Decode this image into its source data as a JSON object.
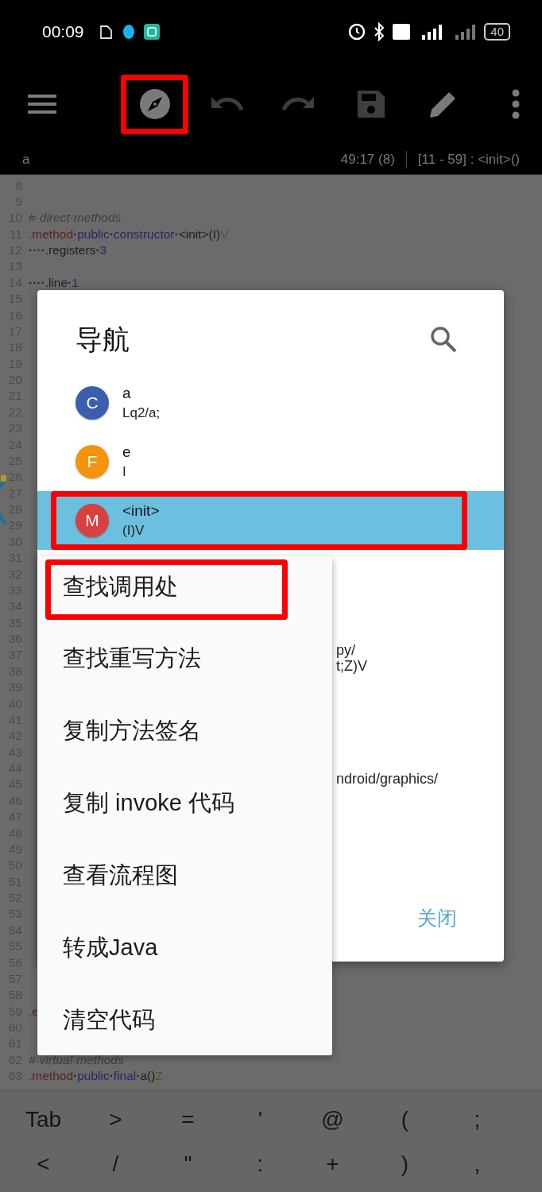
{
  "status_bar": {
    "time": "00:09",
    "battery": "40"
  },
  "toolbar": {
    "buttons": [
      {
        "disabled": false,
        "highlighted": false
      },
      {
        "disabled": false,
        "highlighted": true
      },
      {
        "disabled": true,
        "highlighted": false
      },
      {
        "disabled": true,
        "highlighted": false
      },
      {
        "disabled": true,
        "highlighted": false
      },
      {
        "disabled": false,
        "highlighted": false
      },
      {
        "disabled": false,
        "highlighted": false
      }
    ]
  },
  "info_bar": {
    "file": "a",
    "position": "49:17 (8)",
    "range": "[11 - 59] : <init>()"
  },
  "editor": {
    "lines": [
      {
        "number": "8"
      },
      {
        "number": "9"
      },
      {
        "number": "10",
        "tokens": [
          {
            "kind": "comment",
            "text": "#·direct·methods"
          }
        ]
      },
      {
        "number": "11",
        "tokens": [
          {
            "kind": "directive",
            "text": ".method"
          },
          {
            "kind": "space",
            "text": "·"
          },
          {
            "kind": "keyword",
            "text": "public"
          },
          {
            "kind": "space",
            "text": "·"
          },
          {
            "kind": "keyword",
            "text": "constructor"
          },
          {
            "kind": "space",
            "text": "·"
          },
          {
            "kind": "plain",
            "text": "<init>(I)"
          },
          {
            "kind": "type",
            "text": "V"
          }
        ]
      },
      {
        "number": "12",
        "tokens": [
          {
            "kind": "space",
            "text": "····"
          },
          {
            "kind": "plain",
            "text": ".registers"
          },
          {
            "kind": "space",
            "text": "·"
          },
          {
            "kind": "number",
            "text": "3"
          }
        ]
      },
      {
        "number": "13"
      },
      {
        "number": "14",
        "tokens": [
          {
            "kind": "space",
            "text": "····"
          },
          {
            "kind": "plain",
            "text": ".line"
          },
          {
            "kind": "space",
            "text": "·"
          },
          {
            "kind": "number",
            "text": "1"
          }
        ]
      },
      {
        "number": "15"
      },
      {
        "number": "16"
      },
      {
        "number": "17"
      },
      {
        "number": "18"
      },
      {
        "number": "19"
      },
      {
        "number": "20"
      },
      {
        "number": "21"
      },
      {
        "number": "22"
      },
      {
        "number": "23"
      },
      {
        "number": "24"
      },
      {
        "number": "25"
      },
      {
        "number": "26"
      },
      {
        "number": "27"
      },
      {
        "number": "28"
      },
      {
        "number": "29"
      },
      {
        "number": "30"
      },
      {
        "number": "31"
      },
      {
        "number": "32"
      },
      {
        "number": "33"
      },
      {
        "number": "34"
      },
      {
        "number": "35"
      },
      {
        "number": "36"
      },
      {
        "number": "37"
      },
      {
        "number": "38"
      },
      {
        "number": "39"
      },
      {
        "number": "40"
      },
      {
        "number": "41"
      },
      {
        "number": "42"
      },
      {
        "number": "43"
      },
      {
        "number": "44"
      },
      {
        "number": "45"
      },
      {
        "number": "46"
      },
      {
        "number": "47"
      },
      {
        "number": "48"
      },
      {
        "number": "49"
      },
      {
        "number": "50"
      },
      {
        "number": "51"
      },
      {
        "number": "52"
      },
      {
        "number": "53"
      },
      {
        "number": "54"
      },
      {
        "number": "55"
      },
      {
        "number": "56"
      },
      {
        "number": "57"
      },
      {
        "number": "58"
      },
      {
        "number": "59",
        "tokens": [
          {
            "kind": "directive",
            "text": ".e"
          }
        ]
      },
      {
        "number": "60"
      },
      {
        "number": "61"
      },
      {
        "number": "62",
        "tokens": [
          {
            "kind": "comment",
            "text": "#·virtual·methods"
          }
        ]
      },
      {
        "number": "63",
        "tokens": [
          {
            "kind": "directive",
            "text": ".method"
          },
          {
            "kind": "space",
            "text": "·"
          },
          {
            "kind": "keyword",
            "text": "public"
          },
          {
            "kind": "space",
            "text": "·"
          },
          {
            "kind": "keyword",
            "text": "final"
          },
          {
            "kind": "space",
            "text": "·"
          },
          {
            "kind": "plain",
            "text": "a()"
          },
          {
            "kind": "type",
            "text": "Z"
          }
        ]
      }
    ]
  },
  "navigation_dialog": {
    "title": "导航",
    "items": [
      {
        "letter": "C",
        "color": "#3b5fae",
        "name": "a",
        "signature": "Lq2/a;",
        "selected": false,
        "highlighted": false
      },
      {
        "letter": "F",
        "color": "#f5930c",
        "name": "e",
        "signature": "I",
        "selected": false,
        "highlighted": false
      },
      {
        "letter": "M",
        "color": "#d94040",
        "name": "<init>",
        "signature": "(I)V",
        "selected": true,
        "highlighted": true
      }
    ],
    "covered_texts": [
      {
        "lines": [
          "py/",
          "t;Z)V"
        ]
      },
      {
        "lines": [
          "ndroid/graphics/"
        ]
      }
    ],
    "close_button": "关闭"
  },
  "context_menu": {
    "items": [
      {
        "label": "查找调用处",
        "highlighted": true
      },
      {
        "label": "查找重写方法",
        "highlighted": false
      },
      {
        "label": "复制方法签名",
        "highlighted": false
      },
      {
        "label": "复制 invoke 代码",
        "highlighted": false
      },
      {
        "label": "查看流程图",
        "highlighted": false
      },
      {
        "label": "转成Java",
        "highlighted": false
      },
      {
        "label": "清空代码",
        "highlighted": false
      }
    ]
  },
  "symbol_keys": {
    "rows": [
      [
        "Tab",
        ">",
        "=",
        "'",
        "@",
        "(",
        ";"
      ],
      [
        "<",
        "/",
        "\"",
        ":",
        "+",
        ")",
        ","
      ]
    ]
  }
}
